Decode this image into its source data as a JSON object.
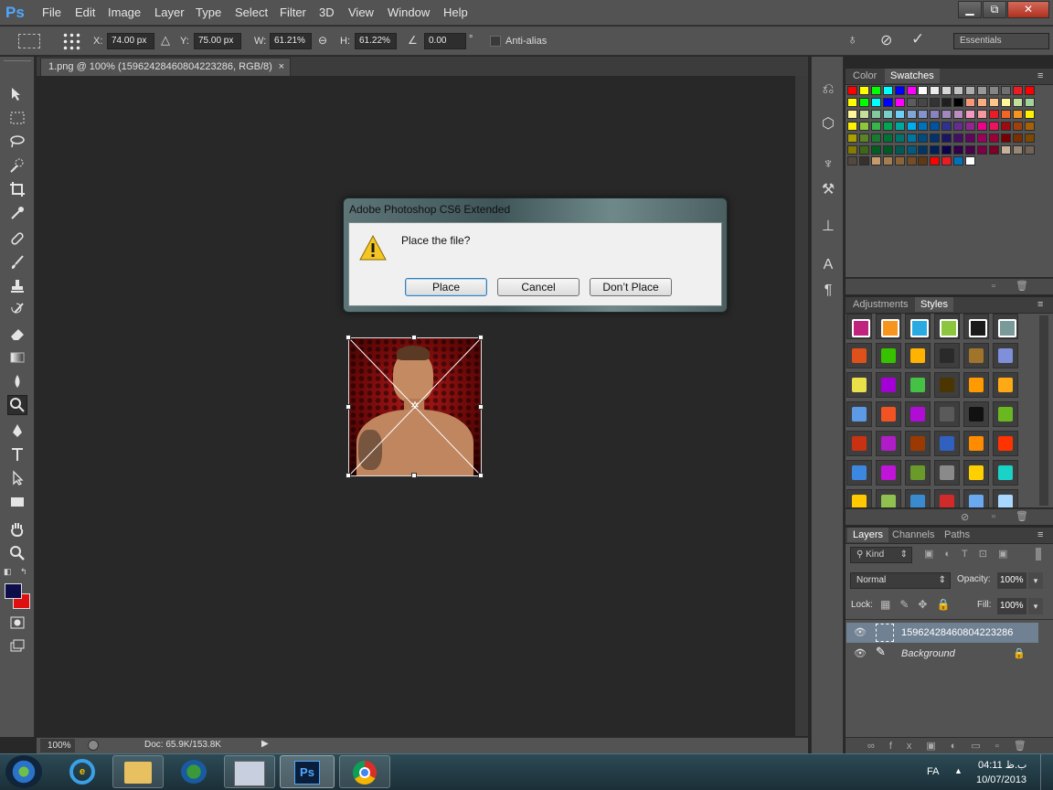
{
  "app": {
    "logo": "Ps"
  },
  "menu": [
    "File",
    "Edit",
    "Image",
    "Layer",
    "Type",
    "Select",
    "Filter",
    "3D",
    "View",
    "Window",
    "Help"
  ],
  "window_controls": {
    "minimize": "▁",
    "restore": "⧉",
    "close": "✕"
  },
  "options": {
    "x_label": "X:",
    "x_value": "74.00 px",
    "y_label": "Y:",
    "y_value": "75.00 px",
    "w_label": "W:",
    "w_value": "61.21%",
    "h_label": "H:",
    "h_value": "61.22%",
    "angle_value": "0.00",
    "angle_unit": "°",
    "antialias_label": "Anti-alias",
    "workspace": "Essentials"
  },
  "document": {
    "tab_title": "1.png @ 100% (15962428460804223286, RGB/8)",
    "tab_close": "×",
    "zoom": "100%",
    "doc_info": "Doc: 65.9K/153.8K"
  },
  "dialog": {
    "title": "Adobe Photoshop CS6 Extended",
    "message": "Place the file?",
    "buttons": {
      "place": "Place",
      "cancel": "Cancel",
      "dont_place": "Don’t Place"
    }
  },
  "panels": {
    "color_tabs": [
      "Color",
      "Swatches"
    ],
    "adjust_tabs": [
      "Adjustments",
      "Styles"
    ],
    "layers_tabs": [
      "Layers",
      "Channels",
      "Paths"
    ],
    "kind_label": "Kind",
    "blend_mode": "Normal",
    "opacity_label": "Opacity:",
    "opacity_value": "100%",
    "lock_label": "Lock:",
    "fill_label": "Fill:",
    "fill_value": "100%",
    "layers": [
      {
        "name": "15962428460804223286",
        "selected": true,
        "locked": false
      },
      {
        "name": "Background",
        "selected": false,
        "locked": true
      }
    ]
  },
  "colors": {
    "foreground": "#0d0d4a",
    "background": "#e01010",
    "accent": "#4fa7ff"
  },
  "swatches": [
    [
      "#ff0000",
      "#ffff00",
      "#00ff00",
      "#00ffff",
      "#0000ff",
      "#ff00ff",
      "#ffffff",
      "#ebebeb",
      "#d6d6d6",
      "#c2c2c2",
      "#adadad",
      "#999999",
      "#858585",
      "#707070",
      "#ed1c24",
      "#ff0000"
    ],
    [
      "#ffff00",
      "#00ff00",
      "#00ffff",
      "#0000ff",
      "#ff00ff",
      "#5c5c5c",
      "#474747",
      "#333333",
      "#1f1f1f",
      "#000000",
      "#f7977a",
      "#f9ad81",
      "#fdc68a",
      "#fff79a",
      "#c4df9b",
      "#a3d39c"
    ],
    [
      "#fff799",
      "#c4df9b",
      "#82ca9d",
      "#7bcdc8",
      "#6ecff6",
      "#7ea7d8",
      "#8493ca",
      "#8882be",
      "#a187be",
      "#bc8dbf",
      "#f49ac2",
      "#f6989d",
      "#ed1c24",
      "#f26522",
      "#f7941d",
      "#fff200"
    ],
    [
      "#fff200",
      "#8dc63f",
      "#39b54a",
      "#00a651",
      "#00a99d",
      "#00aeef",
      "#0072bc",
      "#0054a6",
      "#2e3192",
      "#662d91",
      "#92278f",
      "#ec008c",
      "#ed145b",
      "#9e0b0f",
      "#a0410d",
      "#a36209"
    ],
    [
      "#aba000",
      "#598527",
      "#1a7b30",
      "#007236",
      "#00746b",
      "#0076a3",
      "#004b80",
      "#003471",
      "#1b1464",
      "#440e62",
      "#630460",
      "#9e005d",
      "#9e0039",
      "#790000",
      "#7b2e00",
      "#7d4900"
    ],
    [
      "#827b00",
      "#406618",
      "#005e20",
      "#005826",
      "#005952",
      "#005b7f",
      "#003663",
      "#002157",
      "#0d004c",
      "#32004b",
      "#4b0049",
      "#7b0046",
      "#7a0026",
      "#c7b299",
      "#998675",
      "#736357"
    ],
    [
      "#534741",
      "#37302d",
      "#c69c6d",
      "#a67c52",
      "#8c6239",
      "#754c24",
      "#603913",
      "#ff0000",
      "#ed1c24",
      "#0072bc",
      "#ffffff"
    ]
  ],
  "styles": [
    [
      "#c0237e",
      "#f7941d",
      "#29abe2",
      "#8cc63f",
      "#1a1a1a",
      "#7a9999"
    ],
    [
      "#e0501a",
      "#37c200",
      "#ffb300",
      "#2a2a2a",
      "#a0742a",
      "#7f8fd9"
    ],
    [
      "#eae14a",
      "#a400d6",
      "#45c245",
      "#4b3500",
      "#ff9a00",
      "#ffaa14"
    ],
    [
      "#5c9ae6",
      "#f25322",
      "#b10cd6",
      "#5a5a5a",
      "#111111",
      "#6ab820"
    ],
    [
      "#c83212",
      "#b01cc8",
      "#9a3a00",
      "#3060c0",
      "#ff8c00",
      "#ff3300"
    ],
    [
      "#3c88e0",
      "#c014d8",
      "#6a9a2a",
      "#8a8a8a",
      "#ffd000",
      "#19d2c8"
    ],
    [
      "#ffc800",
      "#8fc050",
      "#3a8ad0",
      "#d02a2a",
      "#6aa8f0",
      "#a8d8ff"
    ]
  ],
  "taskbar": {
    "lang": "FA",
    "time": "04:11 ب.ظ",
    "date": "10/07/2013"
  }
}
